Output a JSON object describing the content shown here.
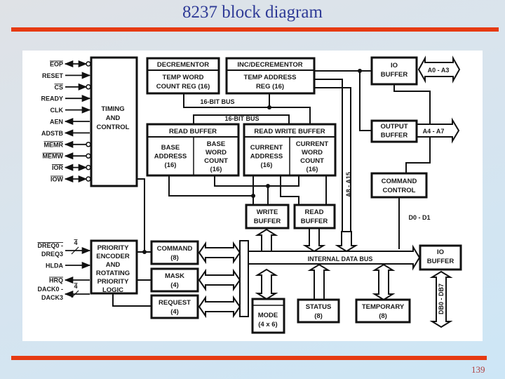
{
  "slide": {
    "title": "8237 block diagram",
    "page_number": "139",
    "accent_color": "#e63a12",
    "title_color": "#2e3a96"
  },
  "diagram": {
    "timing_control": {
      "label": [
        "TIMING",
        "AND",
        "CONTROL"
      ],
      "pins": [
        {
          "name": "EOP",
          "overbar": true,
          "direction": "bidirectional",
          "inverted": true
        },
        {
          "name": "RESET",
          "overbar": false,
          "direction": "in",
          "inverted": false
        },
        {
          "name": "CS",
          "overbar": true,
          "direction": "in",
          "inverted": true
        },
        {
          "name": "READY",
          "overbar": false,
          "direction": "in",
          "inverted": false
        },
        {
          "name": "CLK",
          "overbar": false,
          "direction": "in",
          "inverted": false
        },
        {
          "name": "AEN",
          "overbar": false,
          "direction": "out",
          "inverted": false
        },
        {
          "name": "ADSTB",
          "overbar": false,
          "direction": "out",
          "inverted": false
        },
        {
          "name": "MEMR",
          "overbar": true,
          "direction": "out",
          "inverted": true
        },
        {
          "name": "MEMW",
          "overbar": true,
          "direction": "out",
          "inverted": true
        },
        {
          "name": "IOR",
          "overbar": true,
          "direction": "bidirectional",
          "inverted": true
        },
        {
          "name": "IOW",
          "overbar": true,
          "direction": "bidirectional",
          "inverted": true
        }
      ]
    },
    "decrementor": {
      "header": "DECREMENTOR",
      "body": [
        "TEMP WORD",
        "COUNT REG (16)"
      ]
    },
    "inc_decrementor": {
      "header": "INC/DECREMENTOR",
      "body": [
        "TEMP ADDRESS",
        "REG (16)"
      ]
    },
    "bus_labels": {
      "bus1": "16-BIT BUS",
      "bus2": "16-BIT BUS"
    },
    "read_buffer": {
      "header": "READ BUFFER",
      "cells": [
        [
          "BASE",
          "ADDRESS",
          "(16)"
        ],
        [
          "BASE",
          "WORD",
          "COUNT",
          "(16)"
        ]
      ]
    },
    "read_write_buffer": {
      "header": "READ WRITE BUFFER",
      "cells": [
        [
          "CURRENT",
          "ADDRESS",
          "(16)"
        ],
        [
          "CURRENT",
          "WORD",
          "COUNT",
          "(16)"
        ]
      ]
    },
    "write_buffer": [
      "WRITE",
      "BUFFER"
    ],
    "read_buffer_small": [
      "READ",
      "BUFFER"
    ],
    "io_buffer_top": {
      "label": [
        "IO",
        "BUFFER"
      ],
      "bus": "A0 - A3"
    },
    "output_buffer": {
      "label": [
        "OUTPUT",
        "BUFFER"
      ],
      "bus": "A4 - A7"
    },
    "address_bus_label": "A8 - A15",
    "command_control": {
      "label": [
        "COMMAND",
        "CONTROL"
      ],
      "bus": "D0 - D1"
    },
    "priority": {
      "label": [
        "PRIORITY",
        "ENCODER",
        "AND",
        "ROTATING",
        "PRIORITY",
        "LOGIC"
      ],
      "pins": [
        {
          "lines": [
            "DREQ0 -",
            "DREQ3"
          ],
          "overbar": true,
          "direction": "in",
          "width": "4"
        },
        {
          "lines": [
            "HLDA"
          ],
          "overbar": false,
          "direction": "in",
          "width": ""
        },
        {
          "lines": [
            "HRQ"
          ],
          "overbar": true,
          "direction": "out",
          "width": ""
        },
        {
          "lines": [
            "DACK0 -",
            "DACK3"
          ],
          "overbar": false,
          "direction": "out",
          "width": "4"
        }
      ]
    },
    "registers": [
      {
        "name": "COMMAND",
        "size": "(8)"
      },
      {
        "name": "MASK",
        "size": "(4)"
      },
      {
        "name": "REQUEST",
        "size": "(4)"
      }
    ],
    "mode": [
      "MODE",
      "(4 x 6)"
    ],
    "status": [
      "STATUS",
      "(8)"
    ],
    "temporary": [
      "TEMPORARY",
      "(8)"
    ],
    "internal_bus": "INTERNAL DATA BUS",
    "io_buffer_bottom": {
      "label": [
        "IO",
        "BUFFER"
      ],
      "bus": "DB0 - DB7"
    }
  }
}
